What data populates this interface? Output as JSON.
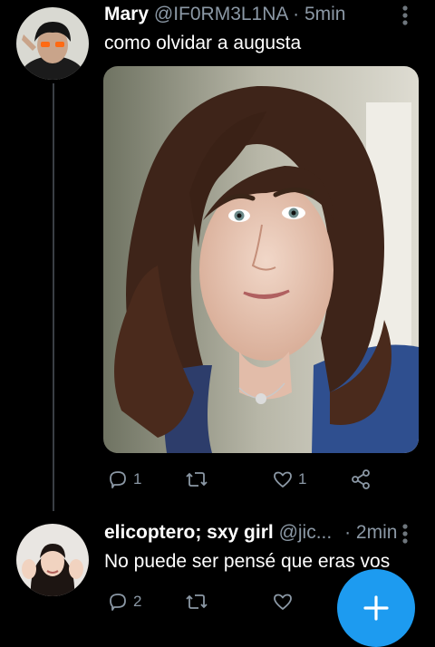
{
  "tweets": [
    {
      "name": "Mary",
      "handle": "@IF0RM3L1NA",
      "separator": "·",
      "time": "5min",
      "text": "como olvidar a augusta",
      "avatar_icon": "avatar-photo",
      "media_icon": "portrait-photo",
      "actions": {
        "reply": {
          "icon": "reply-icon",
          "count": "1"
        },
        "retweet": {
          "icon": "retweet-icon",
          "count": ""
        },
        "like": {
          "icon": "heart-icon",
          "count": "1"
        },
        "share": {
          "icon": "share-icon"
        }
      }
    },
    {
      "name": "elicoptero; sxy girl",
      "handle": "@jic...",
      "separator": "·",
      "time": "2min",
      "text": "No puede ser pensé que eras vos",
      "avatar_icon": "avatar-photo",
      "actions": {
        "reply": {
          "icon": "reply-icon",
          "count": "2"
        },
        "retweet": {
          "icon": "retweet-icon",
          "count": ""
        },
        "like": {
          "icon": "heart-icon",
          "count": ""
        }
      }
    }
  ],
  "fab": {
    "icon": "plus-icon"
  },
  "colors": {
    "background": "#000000",
    "accent": "#1d9bf0",
    "secondary_text": "#8b98a5",
    "thread_line": "#3a3f45"
  }
}
